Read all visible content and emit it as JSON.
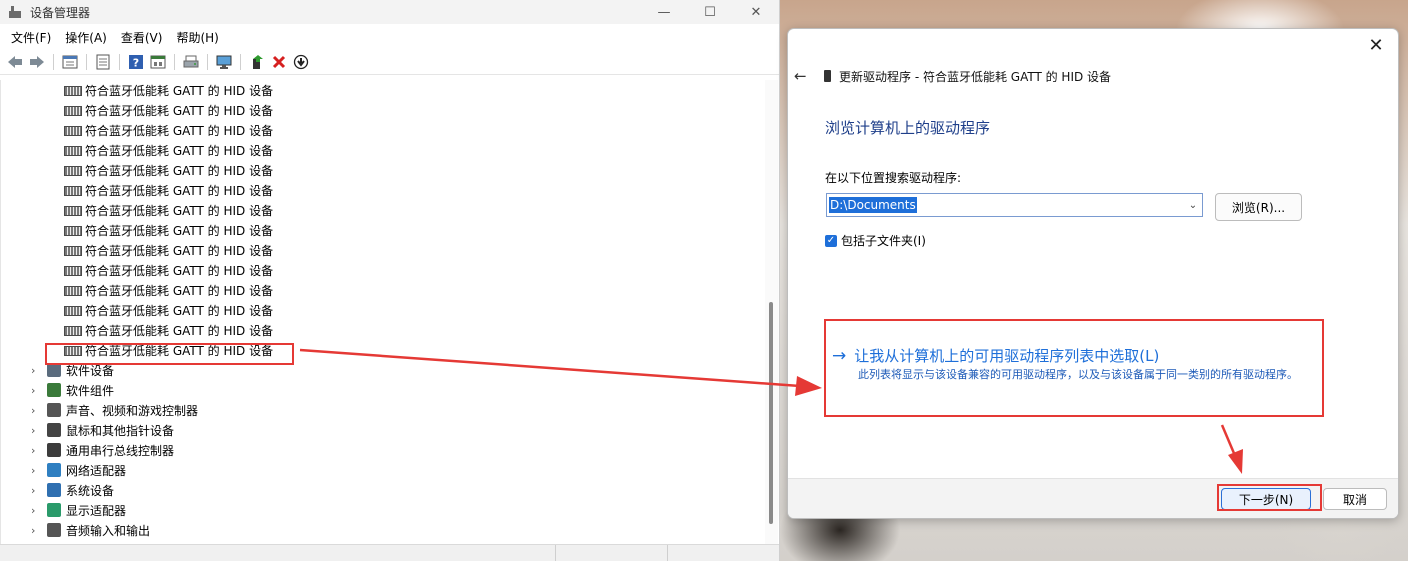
{
  "device_manager": {
    "title": "设备管理器",
    "window_controls": {
      "minimize": "—",
      "maximize": "☐",
      "close": "✕"
    },
    "menu": [
      "文件(F)",
      "操作(A)",
      "查看(V)",
      "帮助(H)"
    ],
    "hid_items": [
      "符合蓝牙低能耗 GATT 的 HID 设备",
      "符合蓝牙低能耗 GATT 的 HID 设备",
      "符合蓝牙低能耗 GATT 的 HID 设备",
      "符合蓝牙低能耗 GATT 的 HID 设备",
      "符合蓝牙低能耗 GATT 的 HID 设备",
      "符合蓝牙低能耗 GATT 的 HID 设备",
      "符合蓝牙低能耗 GATT 的 HID 设备",
      "符合蓝牙低能耗 GATT 的 HID 设备",
      "符合蓝牙低能耗 GATT 的 HID 设备",
      "符合蓝牙低能耗 GATT 的 HID 设备",
      "符合蓝牙低能耗 GATT 的 HID 设备",
      "符合蓝牙低能耗 GATT 的 HID 设备",
      "符合蓝牙低能耗 GATT 的 HID 设备",
      "符合蓝牙低能耗 GATT 的 HID 设备"
    ],
    "categories": [
      {
        "label": "软件设备",
        "icon": "software-device-icon",
        "color": "#5a6b7d"
      },
      {
        "label": "软件组件",
        "icon": "software-component-icon",
        "color": "#3a7a3a"
      },
      {
        "label": "声音、视频和游戏控制器",
        "icon": "speaker-icon",
        "color": "#555555"
      },
      {
        "label": "鼠标和其他指针设备",
        "icon": "mouse-icon",
        "color": "#444444"
      },
      {
        "label": "通用串行总线控制器",
        "icon": "usb-icon",
        "color": "#3c3c3c"
      },
      {
        "label": "网络适配器",
        "icon": "network-adapter-icon",
        "color": "#2f7fc1"
      },
      {
        "label": "系统设备",
        "icon": "system-device-icon",
        "color": "#2f6fb0"
      },
      {
        "label": "显示适配器",
        "icon": "display-adapter-icon",
        "color": "#2a9a6a"
      },
      {
        "label": "音频输入和输出",
        "icon": "audio-io-icon",
        "color": "#555555"
      }
    ],
    "chevron": "›"
  },
  "dialog": {
    "close": "✕",
    "back": "←",
    "header": "更新驱动程序 - 符合蓝牙低能耗 GATT 的 HID 设备",
    "heading": "浏览计算机上的驱动程序",
    "search_label": "在以下位置搜索驱动程序:",
    "path_value": "D:\\Documents",
    "dropdown_glyph": "⌄",
    "browse_label": "浏览(R)...",
    "include_subfolders_label": "包括子文件夹(I)",
    "include_subfolders_checked": true,
    "checkmark": "✓",
    "pick_arrow": "→",
    "pick_link": "让我从计算机上的可用驱动程序列表中选取(L)",
    "pick_desc": "此列表将显示与该设备兼容的可用驱动程序，以及与该设备属于同一类别的所有驱动程序。",
    "next_label": "下一步(N)",
    "cancel_label": "取消"
  },
  "colors": {
    "accent": "#1e6fd9",
    "heading": "#1f3f8a",
    "annotation": "#e53935"
  }
}
